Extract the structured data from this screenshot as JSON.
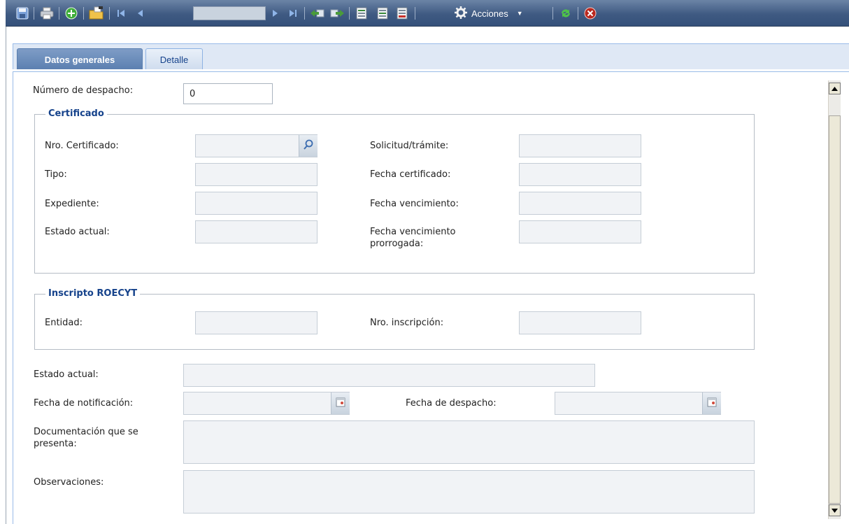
{
  "toolbar": {
    "actions_label": "Acciones",
    "page_value": "",
    "icons": [
      "save-icon",
      "print-icon",
      "add-icon",
      "open-folder-icon",
      "first-icon",
      "prev-icon",
      "next-icon",
      "last-icon",
      "move-left-icon",
      "move-right-icon",
      "report-icon",
      "report-alt-icon",
      "report-red-icon",
      "gear-icon",
      "refresh-icon",
      "close-icon"
    ]
  },
  "tabs": [
    {
      "label": "Datos generales",
      "active": true
    },
    {
      "label": "Detalle",
      "active": false
    }
  ],
  "form": {
    "numero_despacho": {
      "label": "Número de despacho:",
      "value": "0"
    },
    "certificado": {
      "legend": "Certificado",
      "nro_certificado": {
        "label": "Nro. Certificado:",
        "value": ""
      },
      "tipo": {
        "label": "Tipo:",
        "value": ""
      },
      "expediente": {
        "label": "Expediente:",
        "value": ""
      },
      "estado_actual": {
        "label": "Estado actual:",
        "value": ""
      },
      "solicitud": {
        "label": "Solicitud/trámite:",
        "value": ""
      },
      "fecha_certificado": {
        "label": "Fecha certificado:",
        "value": ""
      },
      "fecha_vencimiento": {
        "label": "Fecha vencimiento:",
        "value": ""
      },
      "fecha_vencimiento_prorrogada": {
        "label": "Fecha vencimiento prorrogada:",
        "value": ""
      }
    },
    "roecyt": {
      "legend": "Inscripto ROECYT",
      "entidad": {
        "label": "Entidad:",
        "value": ""
      },
      "nro_inscripcion": {
        "label": "Nro. inscripción:",
        "value": ""
      }
    },
    "estado_actual": {
      "label": "Estado actual:",
      "value": ""
    },
    "fecha_notificacion": {
      "label": "Fecha de notificación:",
      "value": ""
    },
    "fecha_despacho": {
      "label": "Fecha de despacho:",
      "value": ""
    },
    "documentacion": {
      "label": "Documentación que se presenta:",
      "value": ""
    },
    "observaciones": {
      "label": "Observaciones:",
      "value": ""
    }
  }
}
